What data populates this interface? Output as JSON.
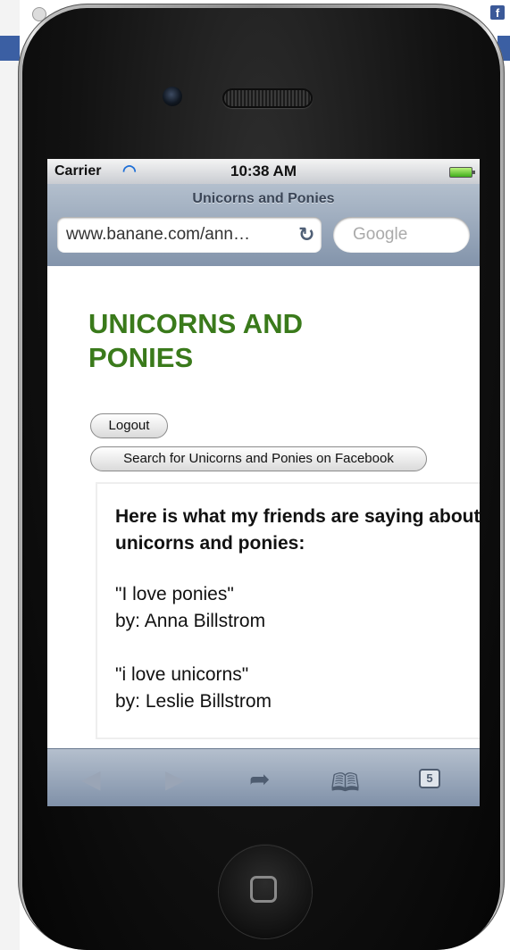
{
  "status_bar": {
    "carrier": "Carrier",
    "time": "10:38 AM"
  },
  "browser": {
    "page_title": "Unicorns and Ponies",
    "url": "www.banane.com/ann…",
    "search_placeholder": "Google",
    "tabs_count": "5"
  },
  "page": {
    "heading": "UNICORNS AND PONIES",
    "logout_label": "Logout",
    "facebook_search_label": "Search for Unicorns and Ponies on Facebook",
    "intro": "Here is what my friends are saying about unicorns and ponies:",
    "quotes": [
      {
        "text": "\"I love ponies\"",
        "author": "by: Anna Billstrom"
      },
      {
        "text": "\"i love unicorns\"",
        "author": "by: Leslie Billstrom"
      }
    ]
  },
  "icons": {
    "wifi": "wifi-icon",
    "battery": "battery-icon",
    "reload": "reload-icon",
    "back": "back-arrow-icon",
    "forward": "forward-arrow-icon",
    "share": "share-icon",
    "bookmarks": "bookmarks-icon",
    "tabs": "tabs-icon",
    "facebook": "facebook-icon"
  },
  "colors": {
    "heading": "#3a7a1b",
    "toolbar": "#8394ab",
    "facebook": "#3b5998"
  }
}
